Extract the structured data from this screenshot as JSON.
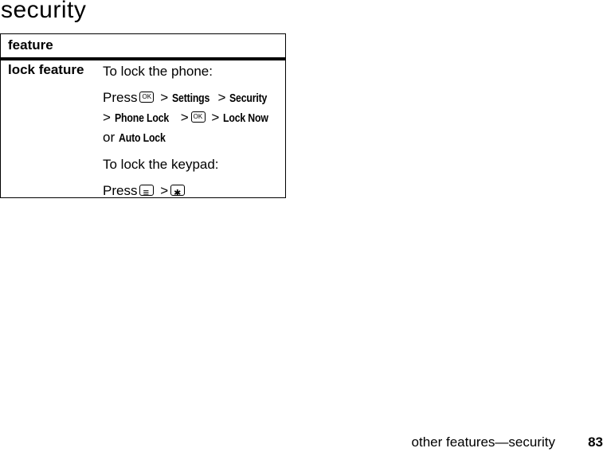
{
  "page": {
    "title": "security",
    "footer_section": "other features—security",
    "page_number": "83"
  },
  "table": {
    "header": "feature",
    "rows": [
      {
        "label": "lock feature",
        "phone": {
          "intro": "To lock the phone:",
          "press": "Press",
          "sep": ">",
          "settings": "Settings",
          "security": "Security",
          "phone_lock": "Phone Lock",
          "lock_now": "Lock Now",
          "or": "or",
          "auto_lock": "Auto Lock"
        },
        "keypad": {
          "intro": "To lock the keypad:",
          "press": "Press",
          "sep": ">"
        }
      }
    ]
  },
  "icons": {
    "ok_key": "ok-key-icon",
    "menu_key": "menu-key-icon",
    "star_key": "star-key-icon"
  }
}
